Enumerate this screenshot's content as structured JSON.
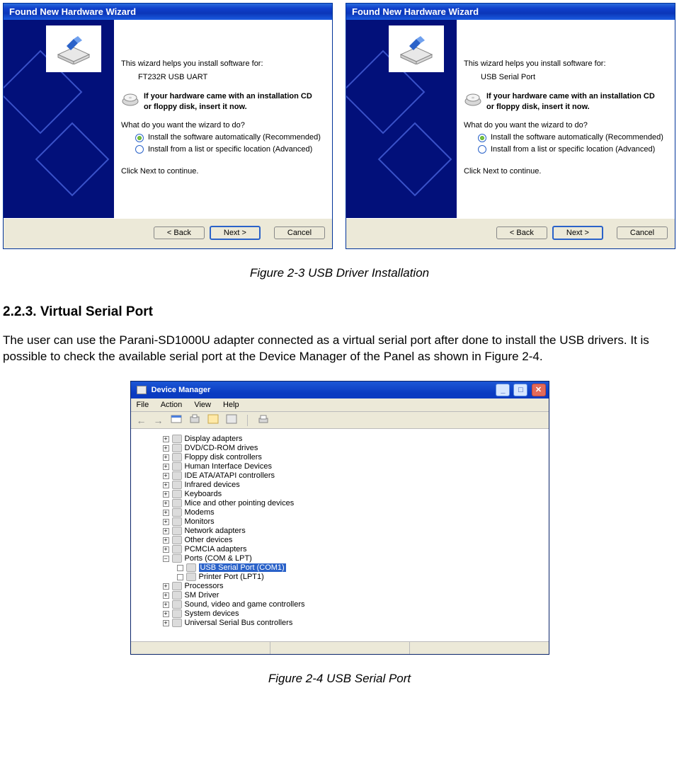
{
  "wizards": [
    {
      "title": "Found New Hardware Wizard",
      "intro": "This wizard helps you install software for:",
      "device": "FT232R USB UART",
      "cd_line1": "If your hardware came with an installation CD",
      "cd_line2": "or floppy disk, insert it now.",
      "question": "What do you want the wizard to do?",
      "opt_auto": "Install the software automatically (Recommended)",
      "opt_list": "Install from a list or specific location (Advanced)",
      "continue_text": "Click Next to continue.",
      "btn_back": "< Back",
      "btn_next": "Next >",
      "btn_cancel": "Cancel"
    },
    {
      "title": "Found New Hardware Wizard",
      "intro": "This wizard helps you install software for:",
      "device": "USB Serial Port",
      "cd_line1": "If your hardware came with an installation CD",
      "cd_line2": "or floppy disk, insert it now.",
      "question": "What do you want the wizard to do?",
      "opt_auto": "Install the software automatically (Recommended)",
      "opt_list": "Install from a list or specific location (Advanced)",
      "continue_text": "Click Next to continue.",
      "btn_back": "< Back",
      "btn_next": "Next >",
      "btn_cancel": "Cancel"
    }
  ],
  "caption1": "Figure 2-3 USB Driver Installation",
  "section_heading": "2.2.3. Virtual Serial Port",
  "section_para": "The user can use the Parani-SD1000U adapter connected as a virtual serial port after done to install the USB drivers. It is possible to check the available serial port at the Device Manager of the Panel as shown in Figure 2-4.",
  "dm": {
    "title": "Device Manager",
    "menu": {
      "file": "File",
      "action": "Action",
      "view": "View",
      "help": "Help"
    },
    "nodes": [
      "Display adapters",
      "DVD/CD-ROM drives",
      "Floppy disk controllers",
      "Human Interface Devices",
      "IDE ATA/ATAPI controllers",
      "Infrared devices",
      "Keyboards",
      "Mice and other pointing devices",
      "Modems",
      "Monitors",
      "Network adapters",
      "Other devices",
      "PCMCIA adapters"
    ],
    "ports_label": "Ports (COM & LPT)",
    "ports_children": {
      "usb": "USB Serial Port (COM1)",
      "lpt": "Printer Port (LPT1)"
    },
    "tail_nodes": [
      "Processors",
      "SM Driver",
      "Sound, video and game controllers",
      "System devices",
      "Universal Serial Bus controllers"
    ]
  },
  "caption2": "Figure 2-4 USB Serial Port"
}
